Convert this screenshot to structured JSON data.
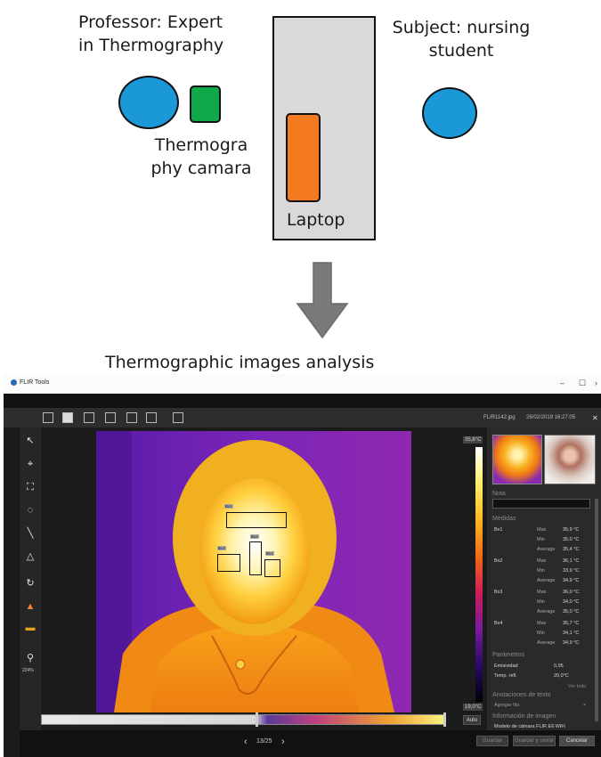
{
  "diagram": {
    "professor_label": [
      "Professor: Expert",
      "in Thermography"
    ],
    "subject_label": [
      "Subject: nursing",
      "student"
    ],
    "camera_label": [
      "Thermogra",
      "phy camara"
    ],
    "laptop_label": "Laptop",
    "analysis_label": "Thermographic images analysis",
    "colors": {
      "person": "#1a98d8",
      "camera": "#10a84a",
      "laptop": "#f47a20",
      "table": "#d9d9d9",
      "arrow": "#7a7a7a"
    }
  },
  "flir": {
    "app_title": "FLIR Tools",
    "file_name": "FLIR1142.jpg",
    "file_date": "26/02/2019 16:27:05",
    "scale_max": "35,8°C",
    "scale_min": "19,0°C",
    "zoom": "224%",
    "nav": {
      "prev": "‹",
      "counter": "13/25",
      "next": "›"
    },
    "auto_button": "Auto",
    "panel": {
      "note_heading": "Nota",
      "measurements_heading": "Medidas",
      "measurements": [
        {
          "name": "Bx1",
          "rows": [
            [
              "Max",
              "35,9 °C"
            ],
            [
              "Min",
              "35,0 °C"
            ],
            [
              "Average",
              "35,4 °C"
            ]
          ]
        },
        {
          "name": "Bx2",
          "rows": [
            [
              "Max",
              "36,1 °C"
            ],
            [
              "Min",
              "33,9 °C"
            ],
            [
              "Average",
              "34,9 °C"
            ]
          ]
        },
        {
          "name": "Bx3",
          "rows": [
            [
              "Max",
              "36,0 °C"
            ],
            [
              "Min",
              "34,0 °C"
            ],
            [
              "Average",
              "35,0 °C"
            ]
          ]
        },
        {
          "name": "Bx4",
          "rows": [
            [
              "Max",
              "35,7 °C"
            ],
            [
              "Min",
              "34,1 °C"
            ],
            [
              "Average",
              "34,9 °C"
            ]
          ]
        }
      ],
      "params_heading": "Parámetros",
      "params": [
        [
          "Emisividad",
          "0,95"
        ],
        [
          "Temp. refl.",
          "20,0°C"
        ]
      ],
      "show_all": "Ver todo",
      "text_annotations_heading": "Anotaciones de texto",
      "add_row": "Agregar fila",
      "image_info_heading": "Información de imagen",
      "image_info_row": "Modelo de cámara  FLIR E6 WiFi"
    },
    "buttons": {
      "save": "Guardar",
      "save_close": "Guardar y cerrar",
      "cancel": "Cancelar"
    },
    "box_tags": [
      "Bx1",
      "Bx2",
      "Bx3",
      "Bx4"
    ]
  }
}
